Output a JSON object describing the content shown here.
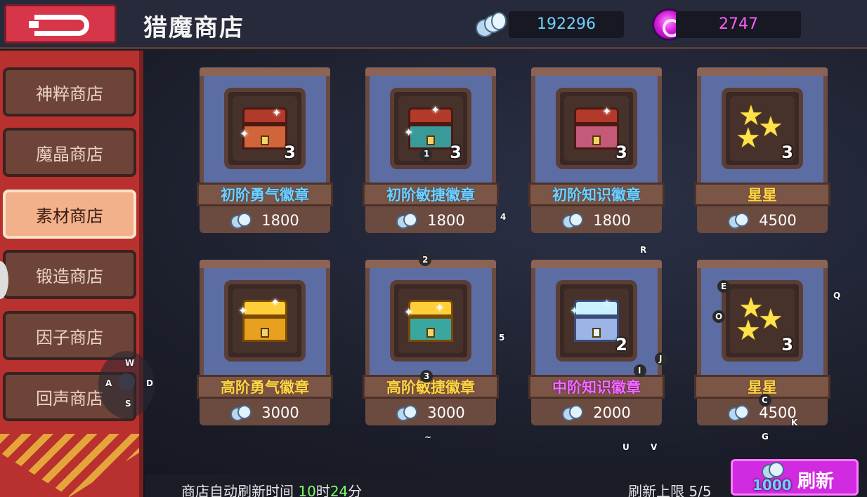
{
  "header": {
    "title": "猎魔商店",
    "currency_silver": "192296",
    "currency_gem": "2747",
    "icons": [
      "back-arrow-icon",
      "silver-coin-icon",
      "purple-gem-icon"
    ]
  },
  "sidebar": {
    "tabs": [
      {
        "label": "神粹商店",
        "active": false
      },
      {
        "label": "魔晶商店",
        "active": false
      },
      {
        "label": "素材商店",
        "active": true
      },
      {
        "label": "锻造商店",
        "active": false
      },
      {
        "label": "因子商店",
        "active": false
      },
      {
        "label": "回声商店",
        "active": false
      }
    ]
  },
  "items": [
    {
      "name": "初阶勇气徽章",
      "count": "3",
      "price": "1800",
      "name_color": "#6fd0ff",
      "icon": "red-chest-icon"
    },
    {
      "name": "初阶敏捷徽章",
      "count": "3",
      "price": "1800",
      "name_color": "#6fd0ff",
      "icon": "teal-chest-icon"
    },
    {
      "name": "初阶知识徽章",
      "count": "3",
      "price": "1800",
      "name_color": "#6fd0ff",
      "icon": "pink-chest-icon"
    },
    {
      "name": "星星",
      "count": "3",
      "price": "4500",
      "name_color": "#ffd54a",
      "icon": "stars-icon"
    },
    {
      "name": "高阶勇气徽章",
      "count": "",
      "price": "3000",
      "name_color": "#ffd54a",
      "icon": "gold-chest-icon"
    },
    {
      "name": "高阶敏捷徽章",
      "count": "",
      "price": "3000",
      "name_color": "#ffd54a",
      "icon": "gold-teal-chest-icon"
    },
    {
      "name": "中阶知识徽章",
      "count": "2",
      "price": "2000",
      "name_color": "#f66bff",
      "icon": "silver-chest-icon"
    },
    {
      "name": "星星",
      "count": "3",
      "price": "4500",
      "name_color": "#ffd54a",
      "icon": "stars-icon"
    }
  ],
  "footer": {
    "auto_refresh_label": "商店自动刷新时间",
    "auto_refresh_hours": "10",
    "hours_unit": "时",
    "auto_refresh_minutes": "24",
    "minutes_unit": "分",
    "refresh_limit": "刷新上限 5/5",
    "refresh_button_label": "刷新",
    "refresh_cost": "1000"
  },
  "key_hints": {
    "h1": "1",
    "h2": "2",
    "h3": "3",
    "h4": "4",
    "h5": "5",
    "R": "R",
    "E": "E",
    "O": "O",
    "Q": "Q",
    "I": "I",
    "J": "J",
    "C": "C",
    "K": "K",
    "G": "G",
    "U": "U",
    "V": "V",
    "W": "W",
    "A": "A",
    "S": "S",
    "D": "D",
    "tilde": "~"
  }
}
